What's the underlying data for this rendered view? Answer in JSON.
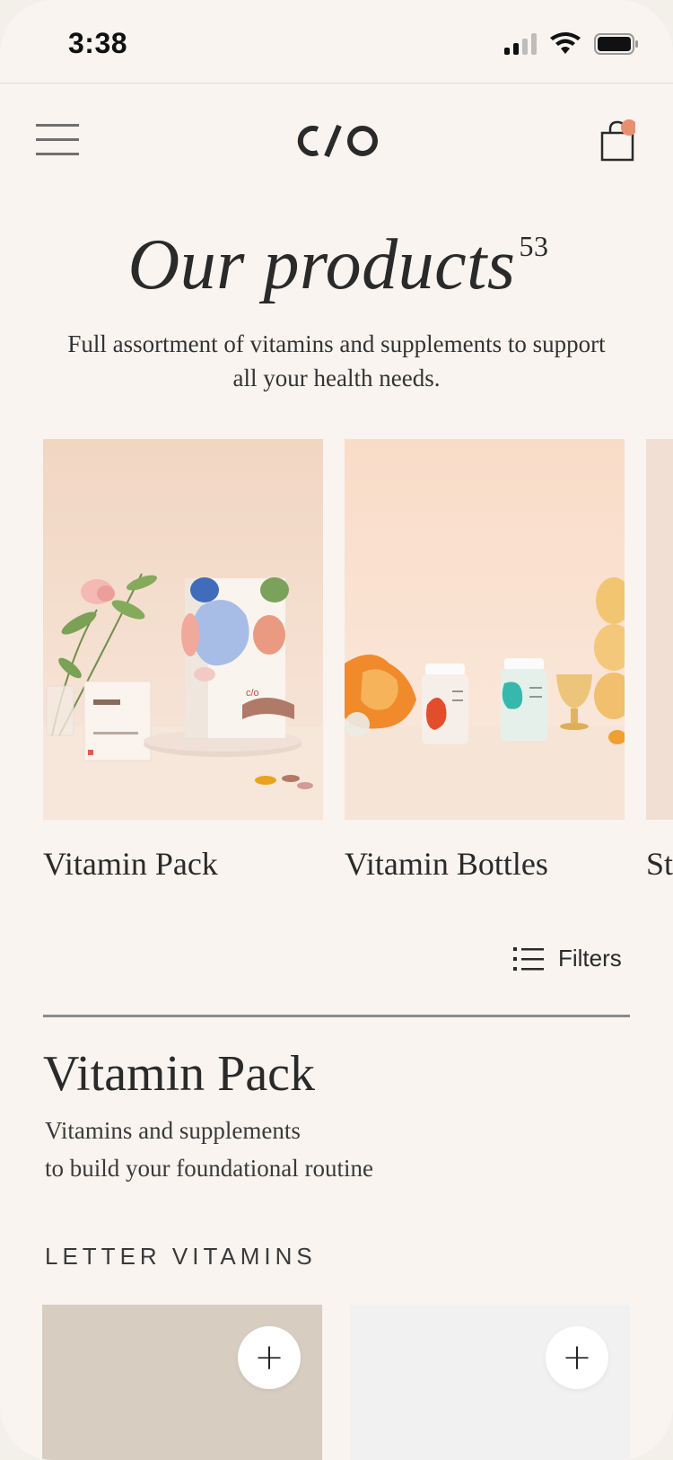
{
  "status_bar": {
    "time": "3:38"
  },
  "header": {
    "logo": "C/O",
    "menu_icon": "hamburger-menu-icon",
    "cart_icon": "shopping-bag-icon",
    "cart_badge_color": "#e88f72"
  },
  "hero": {
    "title": "Our products",
    "count": "53",
    "subtitle": "Full assortment of vitamins and supplements to support all your health needs."
  },
  "categories": [
    {
      "label": "Vitamin Pack"
    },
    {
      "label": "Vitamin Bottles"
    },
    {
      "label": "St"
    }
  ],
  "filters": {
    "label": "Filters",
    "icon": "list-filter-icon"
  },
  "section": {
    "title": "Vitamin Pack",
    "description_line1": "Vitamins and supplements",
    "description_line2": "to build your foundational routine",
    "subsection": "LETTER VITAMINS"
  },
  "products": [
    {
      "add_label": "+",
      "bg": "#d7cdc1"
    },
    {
      "add_label": "+",
      "bg": "#f2f1f1"
    }
  ],
  "colors": {
    "background": "#f9f4f0",
    "text": "#2a2a2a",
    "accent": "#e88f72"
  }
}
